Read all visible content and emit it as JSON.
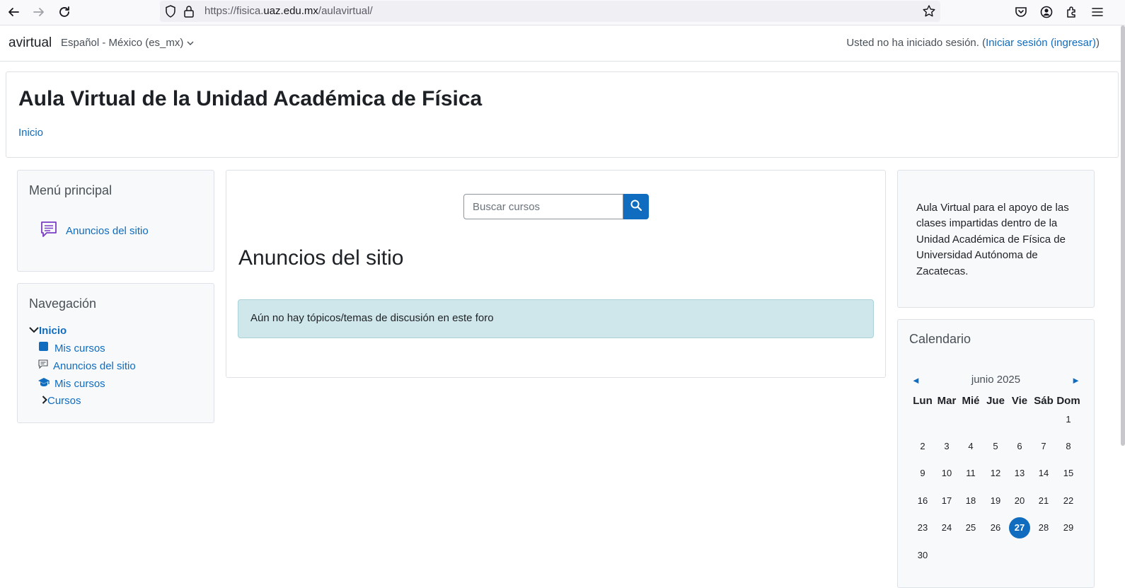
{
  "browser": {
    "url_prefix": "https://fisica.",
    "url_host": "uaz.edu.mx",
    "url_path": "/aulavirtual/"
  },
  "navbar": {
    "brand": "avirtual",
    "language": "Español - México (es_mx)",
    "login_text": "Usted no ha iniciado sesión. (",
    "login_link": "Iniciar sesión (ingresar)",
    "login_close": ")"
  },
  "header": {
    "title": "Aula Virtual de la Unidad Académica de Física",
    "breadcrumb": "Inicio"
  },
  "main_menu": {
    "title": "Menú principal",
    "item": "Anuncios del sitio"
  },
  "navigation": {
    "title": "Navegación",
    "home": "Inicio",
    "items": [
      "Mis cursos",
      "Anuncios del sitio",
      "Mis cursos",
      "Cursos"
    ]
  },
  "main": {
    "search_placeholder": "Buscar cursos",
    "section_title": "Anuncios del sitio",
    "alert": "Aún no hay tópicos/temas de discusión en este foro"
  },
  "about": {
    "text": "Aula Virtual para el apoyo de las clases impartidas dentro de la Unidad Académica de Física de Universidad Autónoma de Zacatecas."
  },
  "calendar": {
    "title": "Calendario",
    "month": "junio 2025",
    "prev": "◄",
    "next": "►",
    "weekdays": [
      "Lun",
      "Mar",
      "Mié",
      "Jue",
      "Vie",
      "Sáb",
      "Dom"
    ],
    "weeks": [
      [
        "",
        "",
        "",
        "",
        "",
        "",
        "1"
      ],
      [
        "2",
        "3",
        "4",
        "5",
        "6",
        "7",
        "8"
      ],
      [
        "9",
        "10",
        "11",
        "12",
        "13",
        "14",
        "15"
      ],
      [
        "16",
        "17",
        "18",
        "19",
        "20",
        "21",
        "22"
      ],
      [
        "23",
        "24",
        "25",
        "26",
        "27",
        "28",
        "29"
      ],
      [
        "30",
        "",
        "",
        "",
        "",
        "",
        ""
      ]
    ],
    "today": "27"
  },
  "colors": {
    "link": "#0f6cbf",
    "alert_bg": "#cfe7ea",
    "block_bg": "#f8f9fa",
    "today_bg": "#0f6cbf"
  }
}
